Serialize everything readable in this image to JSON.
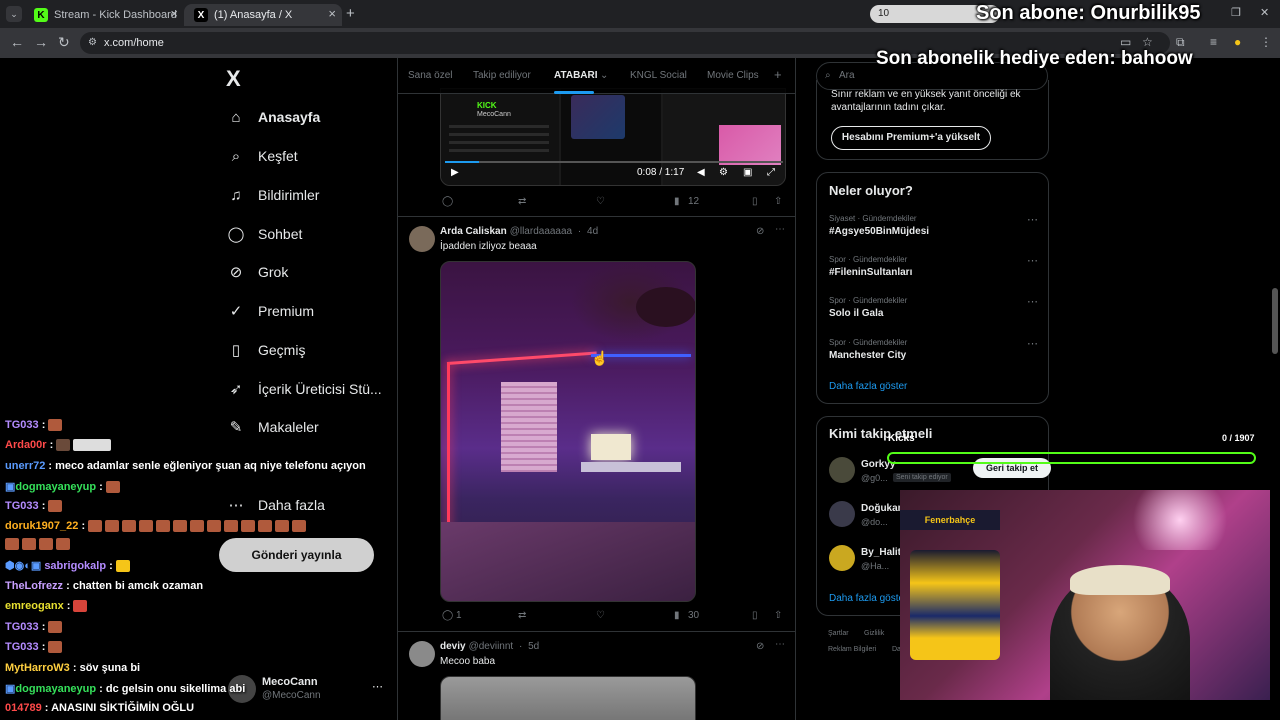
{
  "browser": {
    "tabs": [
      {
        "title": "Stream - Kick Dashboard",
        "favicon": "K"
      },
      {
        "title": "(1) Anasayfa / X",
        "favicon": "X"
      }
    ],
    "url": "x.com/home",
    "search_pill": "10"
  },
  "overlay": {
    "last_sub": "Son abone: Onurbilik95",
    "last_gift": "Son abonelik hediye eden: bahoow",
    "kicks_label": "Kicks",
    "kicks_count": "0 / 1907",
    "kicks_progress": 0
  },
  "sidebar": {
    "logo": "X",
    "items": [
      {
        "label": "Anasayfa",
        "icon": "home-icon"
      },
      {
        "label": "Keşfet",
        "icon": "search-icon"
      },
      {
        "label": "Bildirimler",
        "icon": "bell-icon"
      },
      {
        "label": "Sohbet",
        "icon": "chat-icon"
      },
      {
        "label": "Grok",
        "icon": "grok-icon"
      },
      {
        "label": "Premium",
        "icon": "premium-icon"
      },
      {
        "label": "Geçmiş",
        "icon": "bookmark-icon"
      },
      {
        "label": "İçerik Üreticisi Stü...",
        "icon": "rocket-icon"
      },
      {
        "label": "Makaleler",
        "icon": "article-icon"
      },
      {
        "label": "Daha fazla",
        "icon": "more-icon"
      }
    ],
    "post_button": "Gönderi yayınla",
    "account": {
      "name": "MecoCann",
      "handle": "@MecoCann"
    }
  },
  "feed": {
    "tabs": [
      "Sana özel",
      "Takip ediliyor",
      "ATABARI",
      "KNGL Social",
      "Movie Clips"
    ],
    "video": {
      "time": "0:08 / 1:17",
      "kick_label": "KICK",
      "channel": "MecoCann",
      "progress": 0.1
    },
    "tweet0_actions": {
      "views": "12"
    },
    "tweet1": {
      "name": "Arda Caliskan",
      "handle": "@llardaaaaaa",
      "time": "4d",
      "text": "İpadden izliyoz beaaa",
      "replies": "1",
      "views": "30"
    },
    "tweet2": {
      "name": "deviy",
      "handle": "@deviinnt",
      "time": "5d",
      "text": "Mecoo baba"
    }
  },
  "right": {
    "search_placeholder": "Ara",
    "premium_text": "Sınır reklam ve en yüksek yanıt önceliği ek avantajlarının tadını çıkar.",
    "premium_button": "Hesabını Premium+'a yükselt",
    "trends_title": "Neler oluyor?",
    "trends": [
      {
        "category": "Siyaset · Gündemdekiler",
        "name": "#Agsye50BinMüjdesi"
      },
      {
        "category": "Spor · Gündemdekiler",
        "name": "#FileninSultanları"
      },
      {
        "category": "Spor · Gündemdekiler",
        "name": "Solo il Gala"
      },
      {
        "category": "Spor · Gündemdekiler",
        "name": "Manchester City"
      }
    ],
    "show_more": "Daha fazla göster",
    "follow_title": "Kimi takip etmeli",
    "follow": [
      {
        "name": "Gorkyy",
        "handle": "@g0...",
        "badge": "Seni takip ediyor",
        "button": "Geri takip et"
      },
      {
        "name": "Doğukan",
        "handle": "@do..."
      },
      {
        "name": "By_Halit",
        "handle": "@Ha..."
      }
    ],
    "follow_show_more": "Daha fazla göste",
    "footer": [
      "Şartlar",
      "Gizlilik",
      "Reklam Bilgileri",
      "Da"
    ]
  },
  "chat": [
    {
      "user": "TG033",
      "color": "#b48cff",
      "text": ""
    },
    {
      "user": "Arda00r",
      "color": "#ff4a4a",
      "text": ""
    },
    {
      "user": "unerr72",
      "color": "#5a9bff",
      "text": "meco adamlar senle eğleniyor şuan aq niye telefonu açıyon"
    },
    {
      "user": "dogmayaneyup",
      "color": "#35e05a",
      "text": ""
    },
    {
      "user": "TG033",
      "color": "#b48cff",
      "text": ""
    },
    {
      "user": "doruk1907_22",
      "color": "#ffb020",
      "text": ""
    },
    {
      "user": "sabrigokalp",
      "color": "#b48cff",
      "text": ""
    },
    {
      "user": "TheLofrezz",
      "color": "#c8a0ff",
      "text": "chatten bi amcık ozaman"
    },
    {
      "user": "emreoganx",
      "color": "#e8e030",
      "text": ""
    },
    {
      "user": "TG033",
      "color": "#b48cff",
      "text": ""
    },
    {
      "user": "TG033",
      "color": "#b48cff",
      "text": ""
    },
    {
      "user": "MytHarroW3",
      "color": "#ffd040",
      "text": "söv şuna bi"
    },
    {
      "user": "dogmayaneyup",
      "color": "#35e05a",
      "text": "dc gelsin onu sikellima abi"
    },
    {
      "user": "014789",
      "color": "#ff4a4a",
      "text": "ANASINI SİKTİĞİMİN OĞLU"
    }
  ],
  "webcam": {
    "shirt_text": "Fenerbahçe"
  }
}
